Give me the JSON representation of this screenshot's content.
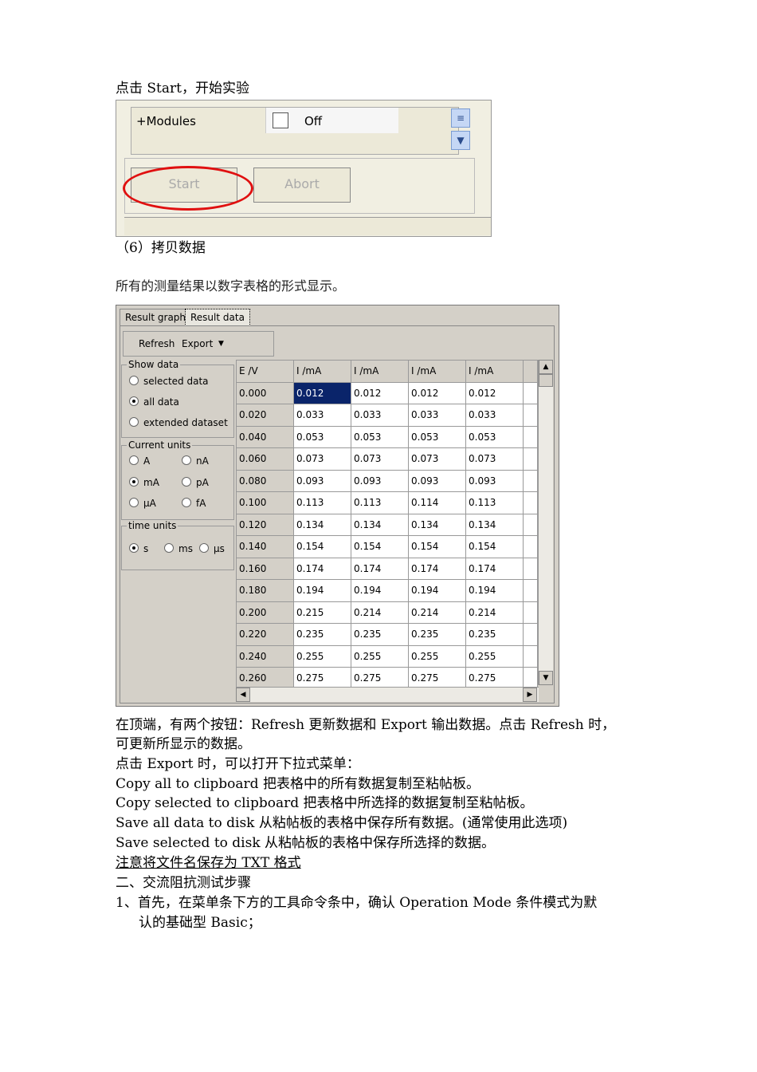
{
  "text": {
    "line1": "点击 Start，开始实验",
    "heading6": "（6）拷贝数据",
    "caption": "所有的测量结果以数字表格的形式显示。",
    "para1a": "在顶端，有两个按钮：Refresh 更新数据和 Export 输出数据。点击 Refresh 时，",
    "para1b": "可更新所显示的数据。",
    "para2": "点击 Export 时，可以打开下拉式菜单：",
    "para3": "Copy all to clipboard 把表格中的所有数据复制至粘帖板。",
    "para4": "Copy selected to clipboard 把表格中所选择的数据复制至粘帖板。",
    "para5": "Save all data to disk 从粘帖板的表格中保存所有数据。(通常使用此选项)",
    "para6": "Save selected to disk 从粘帖板的表格中保存所选择的数据。",
    "note": "注意将文件名保存为 TXT 格式",
    "section2": "二、交流阻抗测试步骤",
    "step1a": "1、首先，在菜单条下方的工具命令条中，确认 Operation Mode 条件模式为默",
    "step1b": "认的基础型 Basic；"
  },
  "shot1": {
    "modules_label": "+Modules",
    "off_label": "Off",
    "start_label": "Start",
    "abort_label": "Abort",
    "highlight_color": "#e01010"
  },
  "shot2": {
    "tabs": [
      "Result graph",
      "Result data"
    ],
    "toolbar": {
      "refresh": "Refresh",
      "export": "Export"
    },
    "show_data": {
      "title": "Show data",
      "options": [
        "selected data",
        "all data",
        "extended dataset"
      ],
      "selected": "all data"
    },
    "current_units": {
      "title": "Current units",
      "options": [
        "A",
        "nA",
        "mA",
        "pA",
        "μA",
        "fA"
      ],
      "selected": "mA"
    },
    "time_units": {
      "title": "time units",
      "options": [
        "s",
        "ms",
        "μs"
      ],
      "selected": "s"
    },
    "columns": [
      "E /V",
      "I /mA",
      "I /mA",
      "I /mA",
      "I /mA"
    ],
    "rows": [
      [
        "0.000",
        "0.012",
        "0.012",
        "0.012",
        "0.012"
      ],
      [
        "0.020",
        "0.033",
        "0.033",
        "0.033",
        "0.033"
      ],
      [
        "0.040",
        "0.053",
        "0.053",
        "0.053",
        "0.053"
      ],
      [
        "0.060",
        "0.073",
        "0.073",
        "0.073",
        "0.073"
      ],
      [
        "0.080",
        "0.093",
        "0.093",
        "0.093",
        "0.093"
      ],
      [
        "0.100",
        "0.113",
        "0.113",
        "0.114",
        "0.113"
      ],
      [
        "0.120",
        "0.134",
        "0.134",
        "0.134",
        "0.134"
      ],
      [
        "0.140",
        "0.154",
        "0.154",
        "0.154",
        "0.154"
      ],
      [
        "0.160",
        "0.174",
        "0.174",
        "0.174",
        "0.174"
      ],
      [
        "0.180",
        "0.194",
        "0.194",
        "0.194",
        "0.194"
      ],
      [
        "0.200",
        "0.215",
        "0.214",
        "0.214",
        "0.214"
      ],
      [
        "0.220",
        "0.235",
        "0.235",
        "0.235",
        "0.235"
      ],
      [
        "0.240",
        "0.255",
        "0.255",
        "0.255",
        "0.255"
      ],
      [
        "0.260",
        "0.275",
        "0.275",
        "0.275",
        "0.275"
      ]
    ],
    "selection_color": "#0a246a"
  }
}
